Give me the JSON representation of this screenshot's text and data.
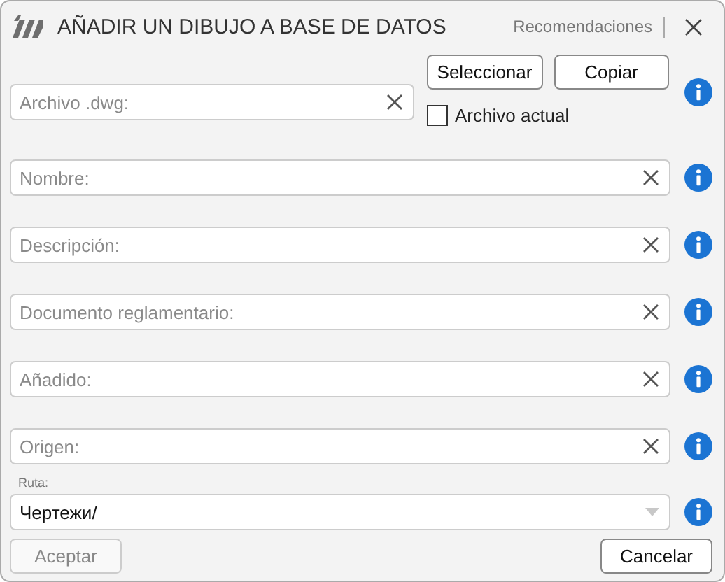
{
  "window": {
    "title": "AÑADIR UN DIBUJO A BASE DE DATOS",
    "help_link": "Recomendaciones"
  },
  "file_row": {
    "placeholder": "Archivo .dwg:",
    "buttons": [
      {
        "label": "Seleccionar"
      },
      {
        "label": "Copiar"
      }
    ],
    "checkbox": {
      "label": "Archivo actual",
      "checked": false
    }
  },
  "fields": [
    {
      "placeholder": "Nombre:"
    },
    {
      "placeholder": "Descripción:"
    },
    {
      "placeholder": "Documento reglamentario:"
    },
    {
      "placeholder": "Añadido:"
    },
    {
      "placeholder": "Origen:"
    }
  ],
  "path": {
    "label": "Ruta:",
    "value": "Чертежи/"
  },
  "footer": [
    {
      "label": "Aceptar",
      "disabled": true
    },
    {
      "label": "Cancelar",
      "disabled": false
    }
  ]
}
